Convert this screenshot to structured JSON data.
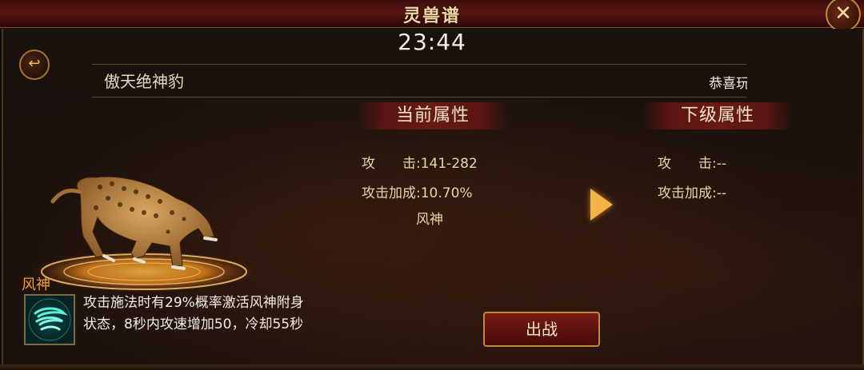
{
  "window": {
    "title": "灵兽谱"
  },
  "timer": "23:44",
  "pet": {
    "name": "傲天绝神豹"
  },
  "announcement": "恭喜玩",
  "current_attrs": {
    "header": "当前属性",
    "attack_label": "攻　　击:",
    "attack_value": "141-282",
    "bonus_label": "攻击加成:",
    "bonus_value": "10.70%",
    "skill": "风神"
  },
  "next_attrs": {
    "header": "下级属性",
    "attack_label": "攻　　击:",
    "attack_value": "--",
    "bonus_label": "攻击加成:",
    "bonus_value": "--"
  },
  "skill": {
    "name": "风神",
    "desc_line1": "攻击施法时有29%概率激活风神附身",
    "desc_line2": "状态，8秒内攻速增加50，冷却55秒"
  },
  "buttons": {
    "close": "✕",
    "back": "↩",
    "fight": "出战"
  },
  "colors": {
    "accent": "#f0a030",
    "gold": "#c08a3a",
    "button_red": "#6a1a15"
  }
}
